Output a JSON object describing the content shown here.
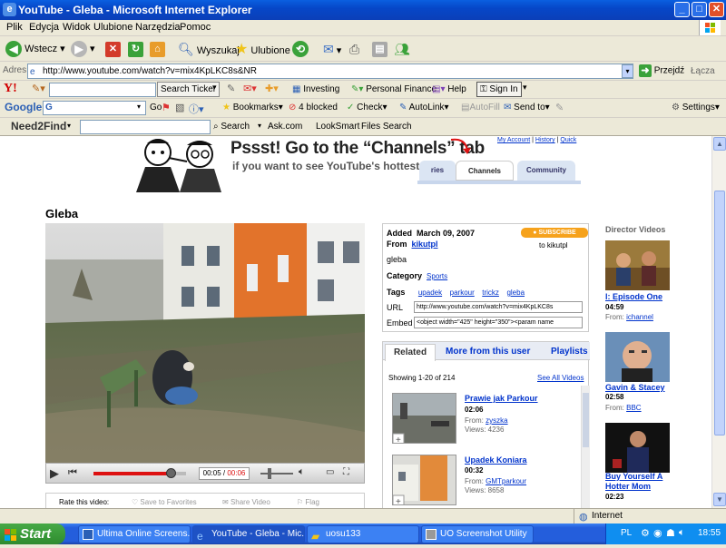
{
  "window": {
    "title": "YouTube - Gleba - Microsoft Internet Explorer"
  },
  "menu": [
    "Plik",
    "Edycja",
    "Widok",
    "Ulubione",
    "Narzędzia",
    "Pomoc"
  ],
  "toolbar": {
    "back": "Wstecz",
    "search": "Wyszukaj",
    "favorites": "Ulubione"
  },
  "address": {
    "label": "Adres",
    "url": "http://www.youtube.com/watch?v=mix4KpLKC8s&NR",
    "go": "Przejdź",
    "links": "Łącza"
  },
  "yahoo": {
    "search_ticker": "Search Ticker",
    "investing": "Investing",
    "personal_finance": "Personal Finance",
    "help": "Help",
    "sign_in": "Sign In"
  },
  "google": {
    "label": "Google",
    "input": "G",
    "go": "Go",
    "bookmarks": "Bookmarks",
    "blocked": "4 blocked",
    "check": "Check",
    "autolink": "AutoLink",
    "autofill": "AutoFill",
    "sendto": "Send to",
    "settings": "Settings"
  },
  "need2find": {
    "logo": "Need2Find",
    "search": "Search",
    "ask": "Ask.com",
    "looksmart": "LookSmart",
    "files_search": "Files Search"
  },
  "banner": {
    "headline": "Pssst! Go to the “Channels” tab",
    "subline": "if you want to see YouTube's hottest stars!",
    "tab_prev": "ries",
    "tab_channels": "Channels",
    "tab_community": "Community",
    "links": [
      "My Account",
      "History",
      "Quick"
    ]
  },
  "video": {
    "title": "Gleba",
    "time_current": "00:05",
    "time_total": "00:06",
    "progress": 0.83,
    "rate_label": "Rate this video:",
    "save_favorites": "Save to Favorites",
    "share_video": "Share Video",
    "flag": "Flag"
  },
  "details": {
    "added_label": "Added",
    "added": "March 09, 2007",
    "from_label": "From",
    "from": "kikutpl",
    "subscribe": "SUBSCRIBE",
    "subscribe_to": "to kikutpl",
    "description": "gleba",
    "category_label": "Category",
    "category": "Sports",
    "tags_label": "Tags",
    "tags": [
      "upadek",
      "parkour",
      "trickz",
      "gleba"
    ],
    "url_label": "URL",
    "url": "http://www.youtube.com/watch?v=mix4KpLKC8s",
    "embed_label": "Embed",
    "embed": "<object width=\"425\" height=\"350\"><param name"
  },
  "related": {
    "tabs": [
      "Related",
      "More from this user",
      "Playlists"
    ],
    "showing": "Showing 1-20 of 214",
    "see_all": "See All Videos",
    "items": [
      {
        "title": "Prawie jak Parkour",
        "duration": "02:06",
        "from_label": "From:",
        "from": "zyszka",
        "views_label": "Views:",
        "views": "4236"
      },
      {
        "title": "Upadek Koniara",
        "duration": "00:32",
        "from_label": "From:",
        "from": "GMTparkour",
        "views_label": "Views:",
        "views": "8658"
      }
    ]
  },
  "director": {
    "heading": "Director Videos",
    "items": [
      {
        "title": "l: Episode One",
        "duration": "04:59",
        "from_label": "From:",
        "from": "ichannel"
      },
      {
        "title": "Gavin & Stacey",
        "duration": "02:58",
        "from_label": "From:",
        "from": "BBC"
      },
      {
        "title": "Buy Yourself A Hotter Mom",
        "duration": "02:23"
      }
    ]
  },
  "statusbar": {
    "zone": "Internet"
  },
  "taskbar": {
    "start": "Start",
    "tasks": [
      "Ultima Online Screens...",
      "YouTube - Gleba - Mic...",
      "uosu133",
      "UO Screenshot Utility"
    ],
    "lang": "PL",
    "clock": "18:55"
  }
}
